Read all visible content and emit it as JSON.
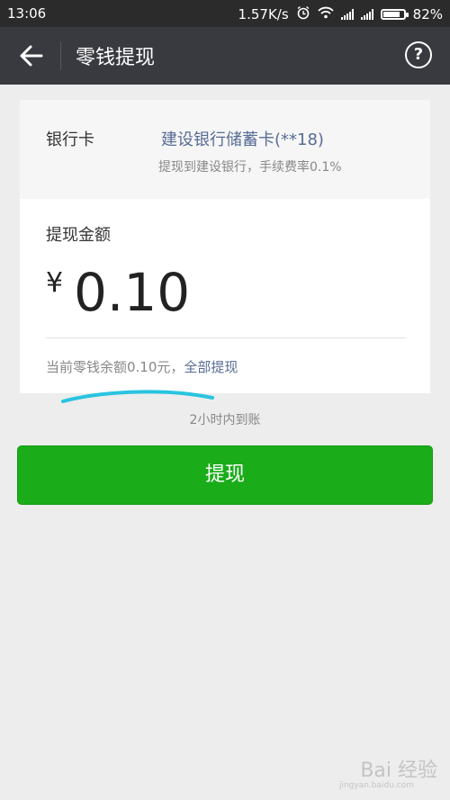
{
  "status_bar": {
    "time": "13:06",
    "net_speed": "1.57K/s",
    "battery_percent": "82%",
    "battery_level": 0.82
  },
  "app_bar": {
    "title": "零钱提现",
    "help_glyph": "?"
  },
  "card": {
    "bank_label": "银行卡",
    "bank_name": "建设银行储蓄卡(**18)",
    "fee_note": "提现到建设银行，手续费率0.1%",
    "amount_label": "提现金额",
    "currency": "¥",
    "amount": "0.10",
    "balance_text": "当前零钱余额0.10元，",
    "withdraw_all": "全部提现"
  },
  "arrival_note": "2小时内到账",
  "button": {
    "label": "提现"
  },
  "colors": {
    "primary_green": "#1aad19",
    "link_blue": "#586c94",
    "annotation_cyan": "#29c4e0",
    "header_dark": "#393a3f"
  },
  "watermark": {
    "logo": "Bai 经验",
    "sub": "jingyan.baidu.com"
  }
}
